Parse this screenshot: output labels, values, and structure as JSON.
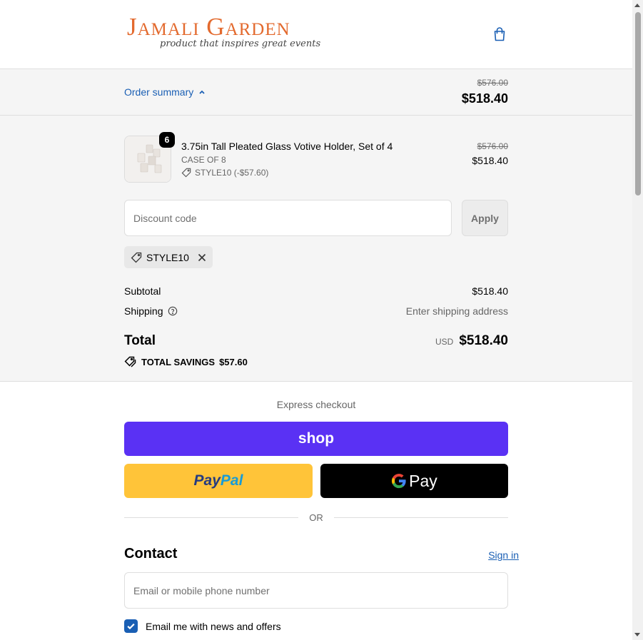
{
  "brand": {
    "logo_main": "Jamali Garden",
    "logo_tagline": "product that inspires great events",
    "accent_color": "#e36a2e"
  },
  "summary_bar": {
    "toggle_label": "Order summary",
    "original_total": "$576.00",
    "total": "$518.40"
  },
  "line_item": {
    "quantity": "6",
    "name": "3.75in Tall Pleated Glass Votive Holder, Set of 4",
    "variant": "CASE OF 8",
    "discount": "STYLE10 (-$57.60)",
    "original_price": "$576.00",
    "price": "$518.40"
  },
  "discount": {
    "placeholder": "Discount code",
    "apply_label": "Apply",
    "applied_code": "STYLE10"
  },
  "totals": {
    "subtotal_label": "Subtotal",
    "subtotal_value": "$518.40",
    "shipping_label": "Shipping",
    "shipping_value": "Enter shipping address",
    "total_label": "Total",
    "currency": "USD",
    "total_value": "$518.40",
    "savings_label": "TOTAL SAVINGS",
    "savings_value": "$57.60"
  },
  "express": {
    "title": "Express checkout",
    "shop_label": "shop",
    "paypal_part1": "Pay",
    "paypal_part2": "Pal",
    "gpay_label": "Pay",
    "or_label": "OR",
    "shop_color": "#5a31f4",
    "paypal_color": "#ffc439"
  },
  "contact": {
    "title": "Contact",
    "signin_label": "Sign in",
    "email_placeholder": "Email or mobile phone number",
    "newsletter_label": "Email me with news and offers",
    "newsletter_checked": true
  }
}
